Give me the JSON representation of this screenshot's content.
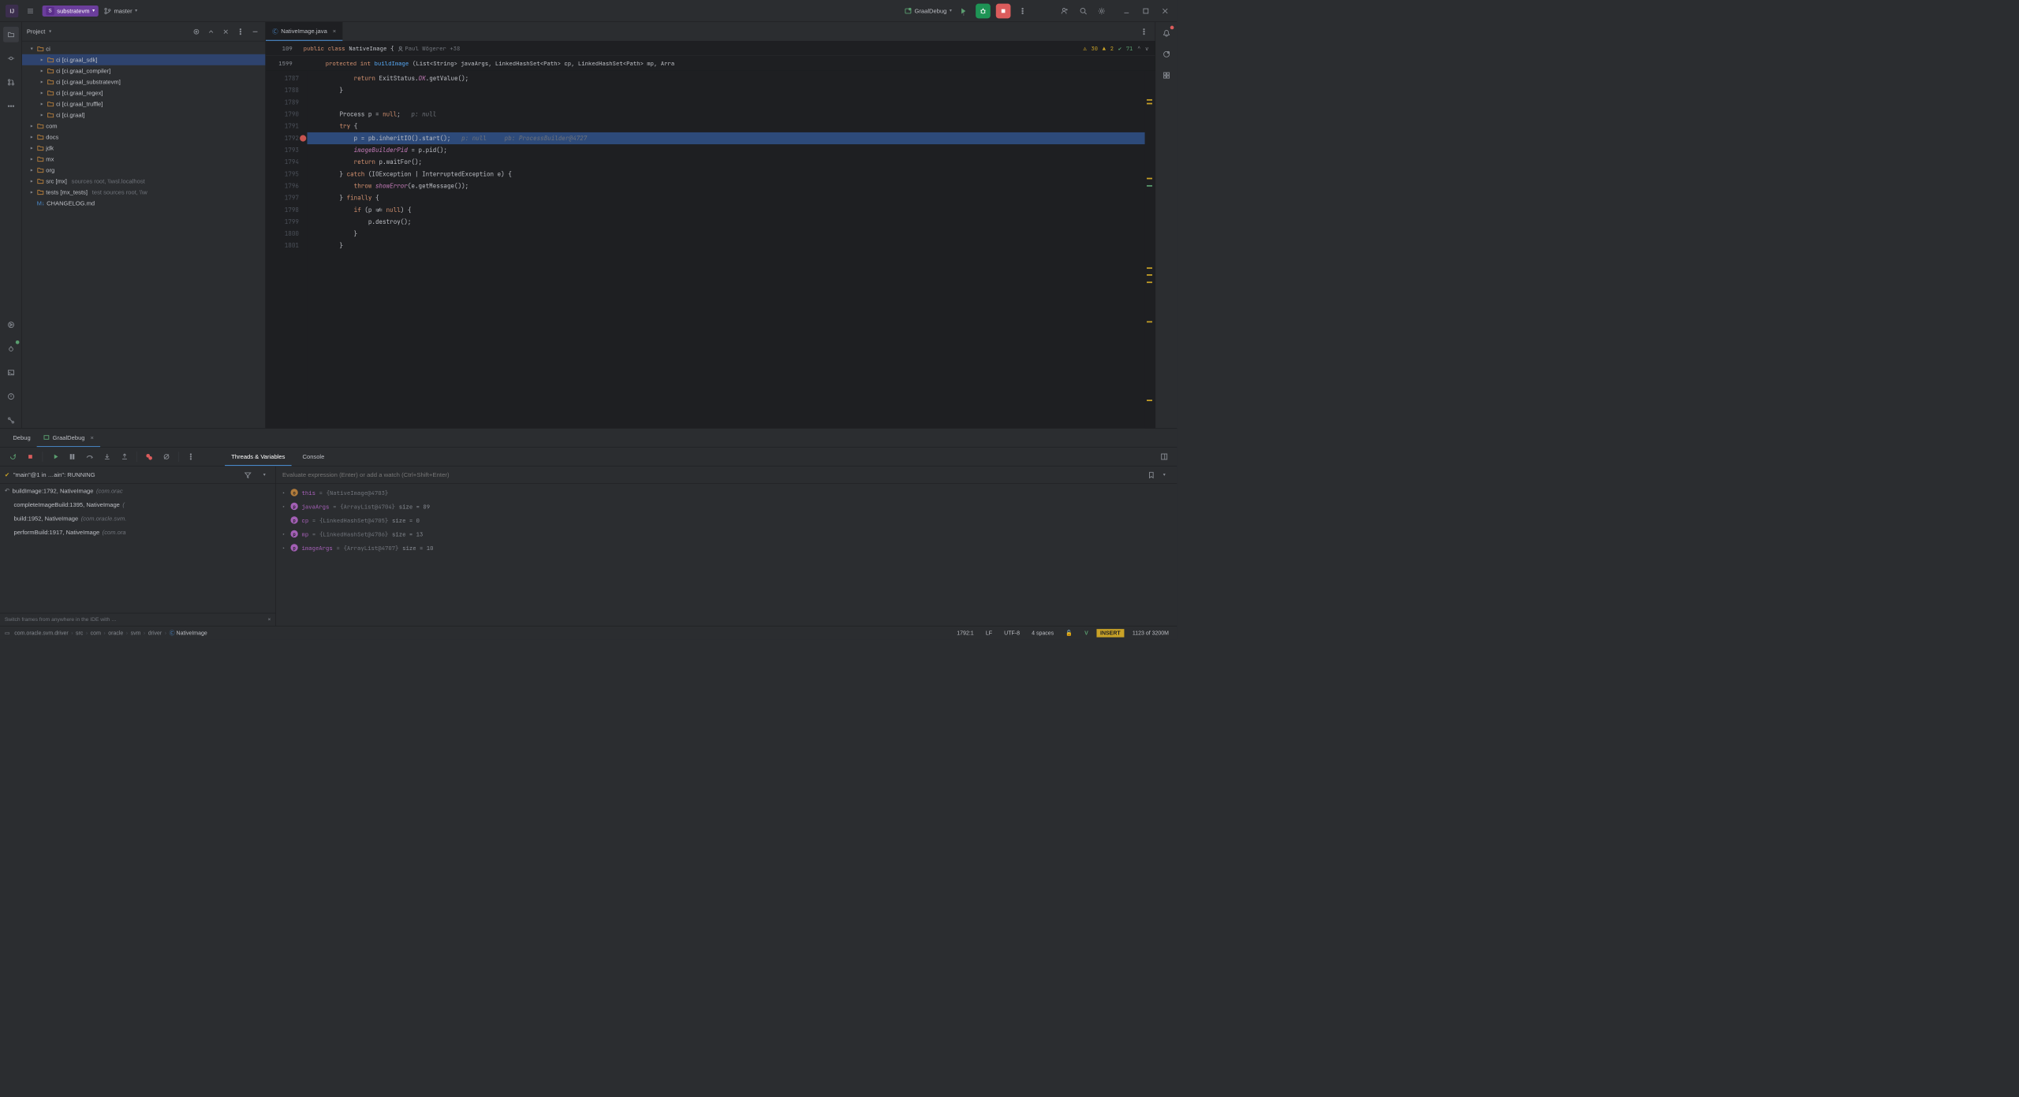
{
  "top": {
    "project_name": "substratevm",
    "project_letter": "S",
    "branch": "master",
    "run_config": "GraalDebug"
  },
  "project_panel": {
    "title": "Project",
    "tree": [
      {
        "depth": 0,
        "chevron": "▾",
        "icon": "folder",
        "label": "ci"
      },
      {
        "depth": 1,
        "chevron": "▸",
        "icon": "folder",
        "label": "ci [ci.graal_sdk]",
        "selected": true
      },
      {
        "depth": 1,
        "chevron": "▸",
        "icon": "folder",
        "label": "ci [ci.graal_compiler]"
      },
      {
        "depth": 1,
        "chevron": "▸",
        "icon": "folder",
        "label": "ci [ci.graal_substratevm]"
      },
      {
        "depth": 1,
        "chevron": "▸",
        "icon": "folder",
        "label": "ci [ci.graal_regex]"
      },
      {
        "depth": 1,
        "chevron": "▸",
        "icon": "folder",
        "label": "ci [ci.graal_truffle]"
      },
      {
        "depth": 1,
        "chevron": "▸",
        "icon": "folder",
        "label": "ci [ci.graal]"
      },
      {
        "depth": 0,
        "chevron": "▸",
        "icon": "folder",
        "label": "com"
      },
      {
        "depth": 0,
        "chevron": "▸",
        "icon": "folder",
        "label": "docs"
      },
      {
        "depth": 0,
        "chevron": "▸",
        "icon": "folder",
        "label": "jdk"
      },
      {
        "depth": 0,
        "chevron": "▸",
        "icon": "folder",
        "label": "mx"
      },
      {
        "depth": 0,
        "chevron": "▸",
        "icon": "folder",
        "label": "org"
      },
      {
        "depth": 0,
        "chevron": "▸",
        "icon": "folder",
        "label": "src [mx]",
        "muted": "sources root,  \\\\wsl.localhost"
      },
      {
        "depth": 0,
        "chevron": "▸",
        "icon": "folder",
        "label": "tests [mx_tests]",
        "muted": "test sources root,  \\\\w"
      },
      {
        "depth": 0,
        "chevron": "",
        "icon": "markdown",
        "label": "CHANGELOG.md"
      }
    ]
  },
  "editor": {
    "tab_name": "NativeImage.java",
    "sig_line": {
      "ln": "109",
      "kw1": "public",
      "kw2": "class",
      "cls": "NativeImage",
      "brace": "{",
      "author": "Paul Wögerer +38"
    },
    "sig_line2": {
      "ln": "1599",
      "kw": "protected",
      "ret": "int",
      "method": "buildImage",
      "params": "(List<String> javaArgs, LinkedHashSet<Path> cp, LinkedHashSet<Path> mp, Arra"
    },
    "inspections": {
      "warn": "30",
      "warn2": "2",
      "ok": "71"
    },
    "lines": [
      {
        "n": "1787",
        "indent": 3,
        "segs": [
          {
            "t": "return ",
            "c": "kw"
          },
          {
            "t": "ExitStatus.",
            "c": ""
          },
          {
            "t": "OK",
            "c": "const"
          },
          {
            "t": ".getValue();",
            "c": ""
          }
        ]
      },
      {
        "n": "1788",
        "indent": 2,
        "segs": [
          {
            "t": "}",
            "c": ""
          }
        ]
      },
      {
        "n": "1789",
        "indent": 0,
        "segs": [
          {
            "t": "",
            "c": ""
          }
        ]
      },
      {
        "n": "1790",
        "indent": 2,
        "segs": [
          {
            "t": "Process p = ",
            "c": ""
          },
          {
            "t": "null",
            "c": "kw"
          },
          {
            "t": ";",
            "c": ""
          },
          {
            "t": "   p: null",
            "c": "cm"
          }
        ]
      },
      {
        "n": "1791",
        "indent": 2,
        "segs": [
          {
            "t": "try",
            "c": "kw"
          },
          {
            "t": " {",
            "c": ""
          }
        ]
      },
      {
        "n": "1792",
        "indent": 3,
        "current": true,
        "bp": true,
        "segs": [
          {
            "t": "p = pb.inheritIO().start();",
            "c": ""
          },
          {
            "t": "   p: null     pb: ProcessBuilder@4727",
            "c": "cm"
          }
        ]
      },
      {
        "n": "1793",
        "indent": 3,
        "segs": [
          {
            "t": "imageBuilderPid",
            "c": "const"
          },
          {
            "t": " = p.pid();",
            "c": ""
          }
        ]
      },
      {
        "n": "1794",
        "indent": 3,
        "segs": [
          {
            "t": "return ",
            "c": "kw"
          },
          {
            "t": "p.waitFor();",
            "c": ""
          }
        ]
      },
      {
        "n": "1795",
        "indent": 2,
        "segs": [
          {
            "t": "} ",
            "c": ""
          },
          {
            "t": "catch",
            "c": "kw"
          },
          {
            "t": " (IOException | InterruptedException e) {",
            "c": ""
          }
        ]
      },
      {
        "n": "1796",
        "indent": 3,
        "segs": [
          {
            "t": "throw ",
            "c": "kw"
          },
          {
            "t": "showError",
            "c": "const"
          },
          {
            "t": "(e.getMessage());",
            "c": ""
          }
        ]
      },
      {
        "n": "1797",
        "indent": 2,
        "segs": [
          {
            "t": "} ",
            "c": ""
          },
          {
            "t": "finally",
            "c": "kw"
          },
          {
            "t": " {",
            "c": ""
          }
        ]
      },
      {
        "n": "1798",
        "indent": 3,
        "segs": [
          {
            "t": "if ",
            "c": "kw"
          },
          {
            "t": "(p != ",
            "c": ""
          },
          {
            "t": "null",
            "c": "kw"
          },
          {
            "t": ") {",
            "c": ""
          }
        ]
      },
      {
        "n": "1799",
        "indent": 4,
        "segs": [
          {
            "t": "p.destroy();",
            "c": ""
          }
        ]
      },
      {
        "n": "1800",
        "indent": 3,
        "segs": [
          {
            "t": "}",
            "c": ""
          }
        ]
      },
      {
        "n": "1801",
        "indent": 2,
        "segs": [
          {
            "t": "}",
            "c": ""
          }
        ]
      }
    ]
  },
  "debug": {
    "tab_main": "Debug",
    "tab_cfg": "GraalDebug",
    "tv_tabs": {
      "threads": "Threads & Variables",
      "console": "Console"
    },
    "thread_header": "\"main\"@1 in …ain\": RUNNING",
    "watch_placeholder": "Evaluate expression (Enter) or add a watch (Ctrl+Shift+Enter)",
    "frames": [
      {
        "label": "buildImage:1792, NativeImage",
        "pkg": "(com.orac",
        "top": true
      },
      {
        "label": "completeImageBuild:1395, NativeImage",
        "pkg": "("
      },
      {
        "label": "build:1952, NativeImage",
        "pkg": "(com.oracle.svm."
      },
      {
        "label": "performBuild:1917, NativeImage",
        "pkg": "(com.ora"
      }
    ],
    "frames_hint": "Switch frames from anywhere in the IDE with …",
    "vars": [
      {
        "chev": "▸",
        "icon": "o",
        "name": "this",
        "eq": " = ",
        "obj": "{NativeImage@4703}",
        "detail": ""
      },
      {
        "chev": "▸",
        "icon": "p",
        "name": "javaArgs",
        "eq": " = ",
        "obj": "{ArrayList@4704}",
        "detail": "  size = 89"
      },
      {
        "chev": "",
        "icon": "p",
        "name": "cp",
        "eq": " = ",
        "obj": "{LinkedHashSet@4705}",
        "detail": "  size = 0"
      },
      {
        "chev": "▸",
        "icon": "p",
        "name": "mp",
        "eq": " = ",
        "obj": "{LinkedHashSet@4706}",
        "detail": "  size = 13"
      },
      {
        "chev": "▸",
        "icon": "p",
        "name": "imageArgs",
        "eq": " = ",
        "obj": "{ArrayList@4707}",
        "detail": "  size = 10"
      }
    ]
  },
  "status": {
    "crumbs": [
      "com.oracle.svm.driver",
      "src",
      "com",
      "oracle",
      "svm",
      "driver",
      "NativeImage"
    ],
    "pos": "1792:1",
    "eol": "LF",
    "enc": "UTF-8",
    "indent": "4 spaces",
    "mode": "INSERT",
    "mem": "1123 of 3200M"
  }
}
